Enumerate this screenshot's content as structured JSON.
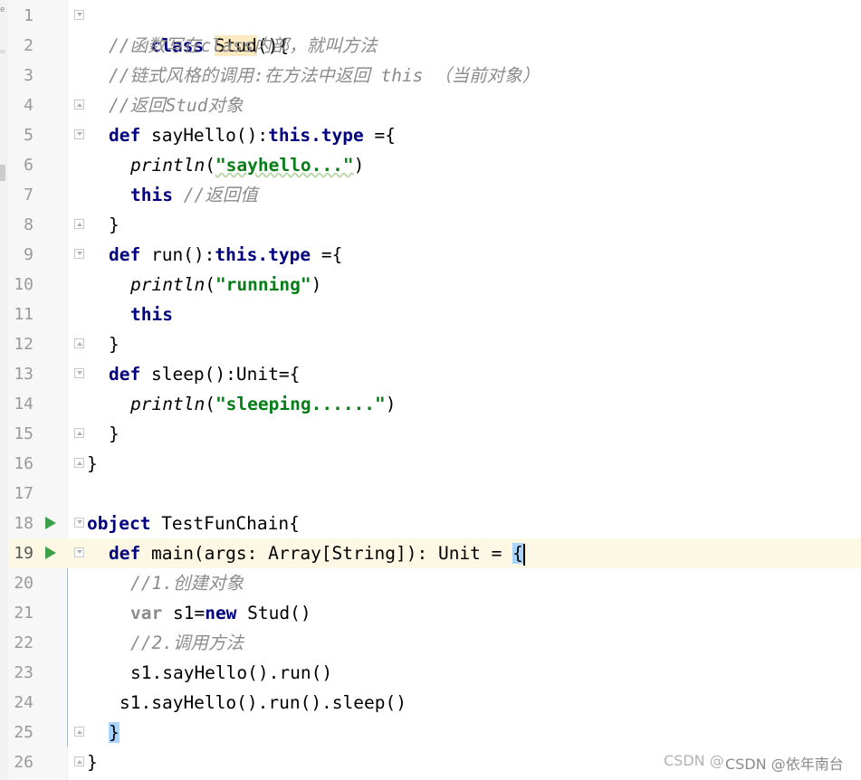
{
  "editor": {
    "lines": [
      {
        "num": "1",
        "kw": "class ",
        "name": "Stud",
        "rest": "(){"
      },
      {
        "num": "2",
        "comment": "//函数写在class内部，就叫方法"
      },
      {
        "num": "3",
        "comment": "//链式风格的调用:在方法中返回 this （当前对象）"
      },
      {
        "num": "4",
        "comment": "//返回Stud对象"
      },
      {
        "num": "5",
        "kw": "def ",
        "a": "sayHello():",
        "kw2": "this.type",
        "b": " ={"
      },
      {
        "num": "6",
        "fn": "println",
        "open": "(",
        "str": "\"sayhello...\"",
        "close": ")"
      },
      {
        "num": "7",
        "kw": "this",
        "comment": " //返回值"
      },
      {
        "num": "8",
        "text": "}"
      },
      {
        "num": "9",
        "kw": "def ",
        "a": "run():",
        "kw2": "this.type",
        "b": " ={"
      },
      {
        "num": "10",
        "fn": "println",
        "open": "(",
        "str": "\"running\"",
        "close": ")"
      },
      {
        "num": "11",
        "kw": "this"
      },
      {
        "num": "12",
        "text": "}"
      },
      {
        "num": "13",
        "kw": "def ",
        "a": "sleep():Unit={"
      },
      {
        "num": "14",
        "fn": "println",
        "open": "(",
        "str": "\"sleeping......\"",
        "close": ")"
      },
      {
        "num": "15",
        "text": "}"
      },
      {
        "num": "16",
        "text": "}"
      },
      {
        "num": "17"
      },
      {
        "num": "18",
        "kw": "object ",
        "a": "TestFunChain{"
      },
      {
        "num": "19",
        "kw": "def ",
        "a": "main(args: Array[String]): Unit = ",
        "brace": "{"
      },
      {
        "num": "20",
        "comment": "//1.创建对象"
      },
      {
        "num": "21",
        "kw": "var ",
        "a": "s1=",
        "kw2": "new",
        "b": " Stud()"
      },
      {
        "num": "22",
        "comment": "//2.调用方法"
      },
      {
        "num": "23",
        "text": "s1.sayHello().run()"
      },
      {
        "num": "24",
        "text": "s1.sayHello().run().sleep()"
      },
      {
        "num": "25",
        "brace": "}"
      },
      {
        "num": "26",
        "text": "}"
      }
    ]
  },
  "watermark": {
    "back": "CSDN @",
    "front": "CSDN @依年南台"
  },
  "colors": {
    "keyword": "#000080",
    "string": "#067d17",
    "comment": "#8c8c8c",
    "run": "#3da04b",
    "current_line": "#fcf8e3"
  }
}
